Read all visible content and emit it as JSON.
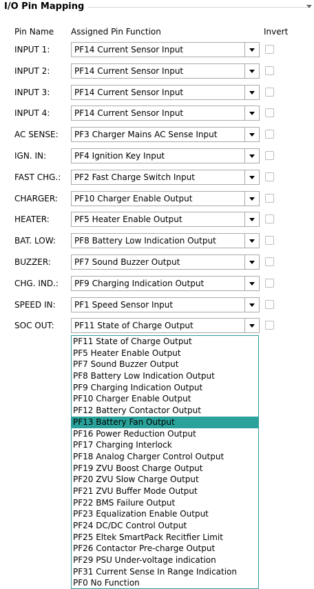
{
  "section_title": "I/O Pin Mapping",
  "headers": {
    "pin_name": "Pin Name",
    "assigned_function": "Assigned Pin Function",
    "invert": "Invert"
  },
  "rows": [
    {
      "label": "INPUT 1:",
      "value": "PF14 Current Sensor Input"
    },
    {
      "label": "INPUT 2:",
      "value": "PF14 Current Sensor Input"
    },
    {
      "label": "INPUT 3:",
      "value": "PF14 Current Sensor Input"
    },
    {
      "label": "INPUT 4:",
      "value": "PF14 Current Sensor Input"
    },
    {
      "label": "AC SENSE:",
      "value": "PF3 Charger Mains AC Sense Input"
    },
    {
      "label": "IGN. IN:",
      "value": "PF4 Ignition Key Input"
    },
    {
      "label": "FAST CHG.:",
      "value": "PF2 Fast Charge Switch Input"
    },
    {
      "label": "CHARGER:",
      "value": "PF10 Charger Enable Output"
    },
    {
      "label": "HEATER:",
      "value": "PF5 Heater Enable Output"
    },
    {
      "label": "BAT. LOW:",
      "value": "PF8 Battery Low Indication Output"
    },
    {
      "label": "BUZZER:",
      "value": "PF7 Sound Buzzer Output"
    },
    {
      "label": "CHG. IND.:",
      "value": "PF9 Charging Indication Output"
    },
    {
      "label": "SPEED IN:",
      "value": "PF1 Speed Sensor Input"
    },
    {
      "label": "SOC OUT:",
      "value": "PF11 State of Charge Output"
    }
  ],
  "dropdown": {
    "highlighted": "PF13 Battery Fan Output",
    "options": [
      "PF11 State of Charge Output",
      "PF5 Heater Enable Output",
      "PF7 Sound Buzzer Output",
      "PF8 Battery Low Indication Output",
      "PF9 Charging Indication Output",
      "PF10 Charger Enable Output",
      "PF12 Battery Contactor Output",
      "PF13 Battery Fan Output",
      "PF16 Power Reduction Output",
      "PF17 Charging Interlock",
      "PF18 Analog Charger Control Output",
      "PF19 ZVU Boost Charge Output",
      "PF20 ZVU Slow Charge Output",
      "PF21 ZVU Buffer Mode Output",
      "PF22 BMS Failure Output",
      "PF23 Equalization Enable Output",
      "PF24 DC/DC Control Output",
      "PF25 Eltek SmartPack Recitfier Limit",
      "PF26 Contactor Pre-charge Output",
      "PF29 PSU Under-voltage indication",
      "PF31 Current Sense In Range Indication",
      "PF0 No Function"
    ]
  },
  "colors": {
    "selection": "#2aa19a",
    "dropdown_border": "#2e9a9a"
  },
  "icons": {
    "combo_button": "chevron-down-icon",
    "group_corner": "triangle-down-icon"
  }
}
